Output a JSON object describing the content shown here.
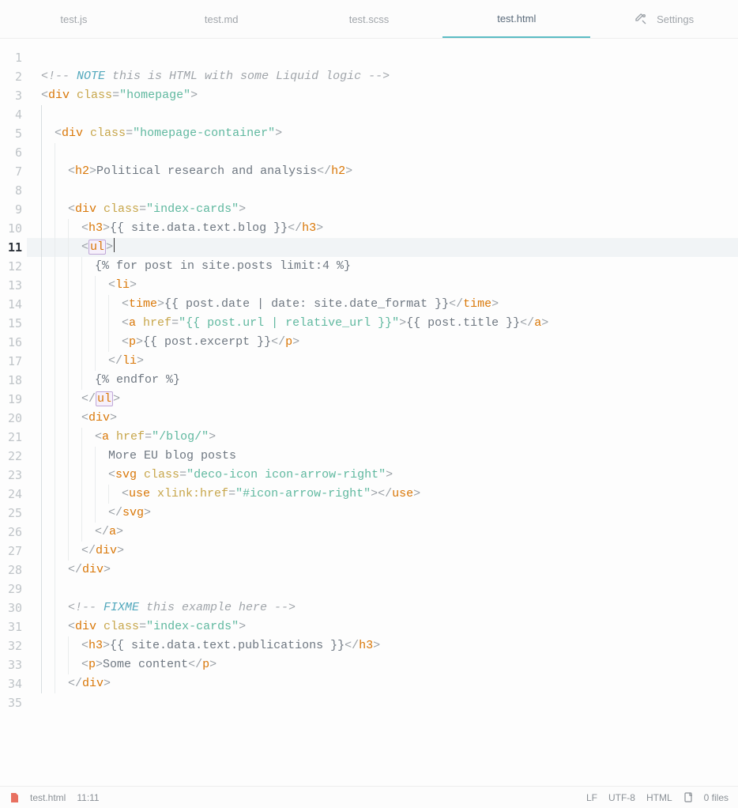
{
  "tabs": [
    {
      "label": "test.js"
    },
    {
      "label": "test.md"
    },
    {
      "label": "test.scss"
    },
    {
      "label": "test.html",
      "active": true
    }
  ],
  "settings": {
    "label": "Settings"
  },
  "editor": {
    "total_lines": 35,
    "active_line": 11,
    "lines": [
      "",
      "<!-- NOTE this is HTML with some Liquid logic -->",
      "<div class=\"homepage\">",
      "",
      "  <div class=\"homepage-container\">",
      "",
      "    <h2>Political research and analysis</h2>",
      "",
      "    <div class=\"index-cards\">",
      "      <h3>{{ site.data.text.blog }}</h3>",
      "      <ul>",
      "        {% for post in site.posts limit:4 %}",
      "          <li>",
      "            <time>{{ post.date | date: site.date_format }}</time>",
      "            <a href=\"{{ post.url | relative_url }}\">{{ post.title }}</a>",
      "            <p>{{ post.excerpt }}</p>",
      "          </li>",
      "        {% endfor %}",
      "      </ul>",
      "      <div>",
      "        <a href=\"/blog/\">",
      "          More EU blog posts",
      "          <svg class=\"deco-icon icon-arrow-right\">",
      "            <use xlink:href=\"#icon-arrow-right\"></use>",
      "          </svg>",
      "        </a>",
      "      </div>",
      "    </div>",
      "",
      "    <!-- FIXME this example here -->",
      "    <div class=\"index-cards\">",
      "      <h3>{{ site.data.text.publications }}</h3>",
      "      <p>Some content</p>",
      "    </div>",
      ""
    ]
  },
  "status": {
    "filename": "test.html",
    "cursor": "11:11",
    "eol": "LF",
    "encoding": "UTF-8",
    "lang": "HTML",
    "files": "0 files"
  },
  "colors": {
    "accent": "#5bbcc4"
  }
}
